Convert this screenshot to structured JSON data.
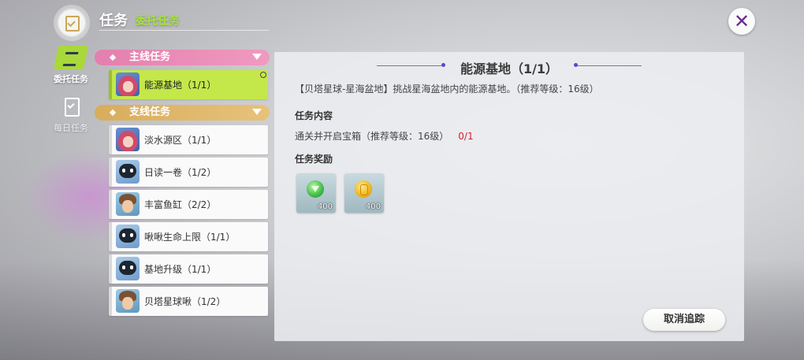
{
  "header": {
    "title": "任务",
    "subtitle": "委托任务",
    "close_icon": "close-icon"
  },
  "tabs": [
    {
      "label": "委托任务",
      "icon": "commission-icon",
      "active": true
    },
    {
      "label": "每日任务",
      "icon": "clipboard-check-icon",
      "active": false
    }
  ],
  "sections": {
    "main": {
      "label": "主线任务",
      "color": "#e37fae"
    },
    "side": {
      "label": "支线任务",
      "color": "#d8ad5c"
    }
  },
  "main_quests": [
    {
      "name": "能源基地（1/1）",
      "avatar": "girl-avatar",
      "active": true
    }
  ],
  "side_quests": [
    {
      "name": "淡水源区（1/1）",
      "avatar": "girl-avatar"
    },
    {
      "name": "日读一卷（1/2）",
      "avatar": "robot-avatar"
    },
    {
      "name": "丰富鱼缸（2/2）",
      "avatar": "boy-avatar"
    },
    {
      "name": "啾啾生命上限（1/1）",
      "avatar": "robot-avatar"
    },
    {
      "name": "基地升级（1/1）",
      "avatar": "robot-avatar"
    },
    {
      "name": "贝塔星球啾（1/2）",
      "avatar": "boy-avatar"
    }
  ],
  "detail": {
    "title": "能源基地（1/1）",
    "description": "【贝塔星球-星海盆地】挑战星海盆地内的能源基地。（推荐等级：16级）",
    "content_heading": "任务内容",
    "objective": "通关并开启宝箱（推荐等级：16级）",
    "objective_progress": "0/1",
    "reward_heading": "任务奖励",
    "rewards": [
      {
        "item": "green-gem-icon",
        "quantity": "400"
      },
      {
        "item": "gold-coin-icon",
        "quantity": "400"
      }
    ],
    "untrack_label": "取消追踪"
  },
  "colors": {
    "accent_green": "#a6e23a",
    "progress_red": "#d7202d",
    "panel_bg": "#ecedf0"
  }
}
